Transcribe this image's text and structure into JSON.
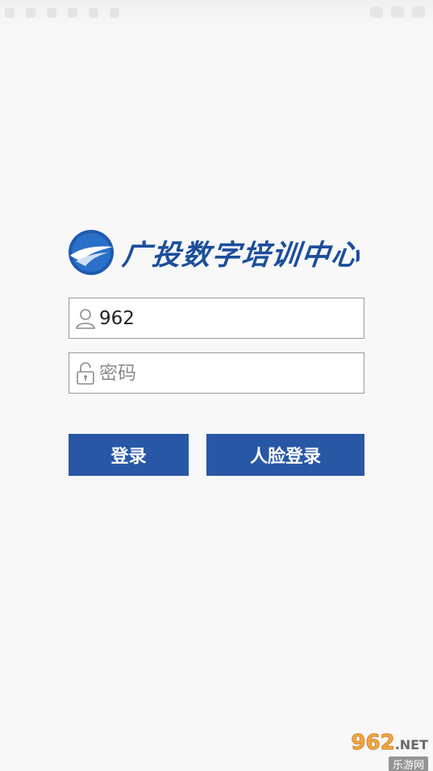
{
  "status_bar": {
    "left_icons": [
      "notification-icon",
      "notification-icon",
      "notification-icon",
      "notification-icon",
      "notification-icon",
      "notification-icon"
    ],
    "right_icons": [
      "wifi-icon",
      "signal-icon",
      "battery-icon"
    ]
  },
  "brand": {
    "title": "广投数字培训中心",
    "logo_icon": "airline-globe-logo",
    "color": "#1b4e9b"
  },
  "login_form": {
    "username": {
      "value": "962",
      "icon": "user-icon"
    },
    "password": {
      "value": "",
      "placeholder": "密码",
      "icon": "lock-icon"
    }
  },
  "buttons": {
    "login_label": "登录",
    "face_login_label": "人脸登录",
    "color": "#2857a6"
  },
  "watermark": {
    "brand": "962",
    "suffix": ".NET",
    "subtitle": "乐游网"
  }
}
